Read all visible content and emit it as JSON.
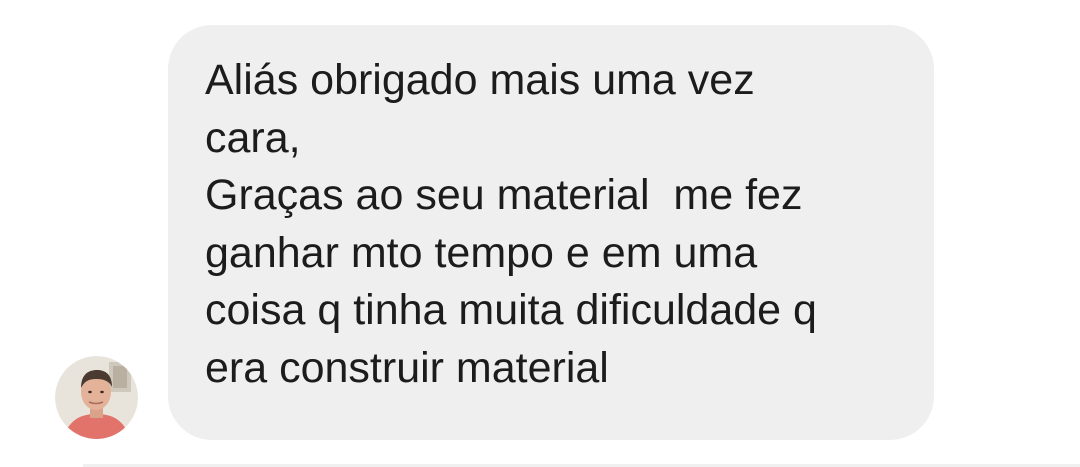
{
  "conversation": {
    "message": {
      "text": "Aliás obrigado mais uma vez\ncara,\nGraças ao seu material  me fez\nganhar mto tempo e em uma\ncoisa q tinha muita dificuldade q\nera construir material"
    },
    "sender": {
      "avatar_icon": "user-avatar-photo"
    }
  },
  "colors": {
    "bubble_background": "#efefef",
    "text": "#1c1c1c",
    "page_background": "#ffffff"
  }
}
